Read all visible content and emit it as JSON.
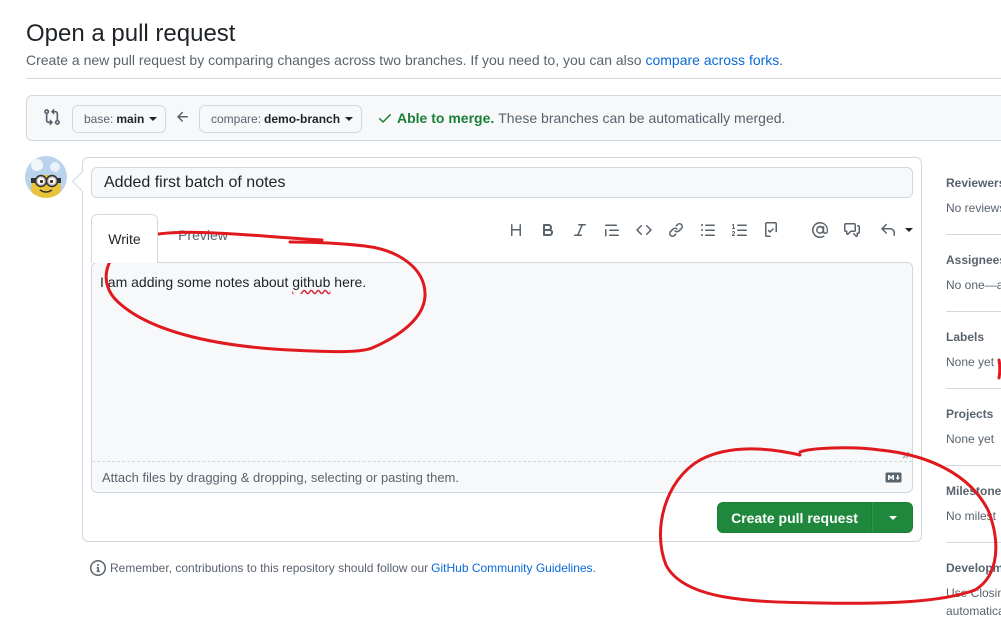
{
  "header": {
    "title": "Open a pull request",
    "subtitle": "Create a new pull request by comparing changes across two branches. If you need to, you can also",
    "subtitle_link": "compare across forks",
    "subtitle_end": "."
  },
  "range": {
    "base_label": "base:",
    "base_value": "main",
    "compare_label": "compare:",
    "compare_value": "demo-branch",
    "merge_ok": "Able to merge.",
    "merge_text": "These branches can be automatically merged."
  },
  "form": {
    "title_value": "Added first batch of notes",
    "tabs": [
      {
        "label": "Write"
      },
      {
        "label": "Preview"
      }
    ],
    "body_pre": "I am adding some notes about ",
    "body_misspelled": "github",
    "body_post": " here.",
    "attach_hint": "Attach files by dragging & dropping, selecting or pasting them.",
    "submit_label": "Create pull request"
  },
  "toolbar_icons": [
    "heading-icon",
    "bold-icon",
    "italic-icon",
    "quote-icon",
    "code-icon",
    "link-icon",
    "unordered-list-icon",
    "ordered-list-icon",
    "task-list-icon",
    "mention-icon",
    "reference-icon",
    "reply-icon"
  ],
  "guidelines": {
    "text": "Remember, contributions to this repository should follow our",
    "link": "GitHub Community Guidelines",
    "end": "."
  },
  "sidebar": {
    "sections": [
      {
        "heading": "Reviewers",
        "value": "No reviews"
      },
      {
        "heading": "Assignees",
        "value": "No one—as"
      },
      {
        "heading": "Labels",
        "value": "None yet"
      },
      {
        "heading": "Projects",
        "value": "None yet"
      },
      {
        "heading": "Milestone",
        "value": "No milest"
      },
      {
        "heading": "Developm",
        "value": "Use Closin",
        "value2": "automatica"
      }
    ]
  },
  "colors": {
    "link": "#0969da",
    "success": "#1a7f37",
    "button_green": "#1f883d",
    "annotation_red": "#e0191f"
  }
}
